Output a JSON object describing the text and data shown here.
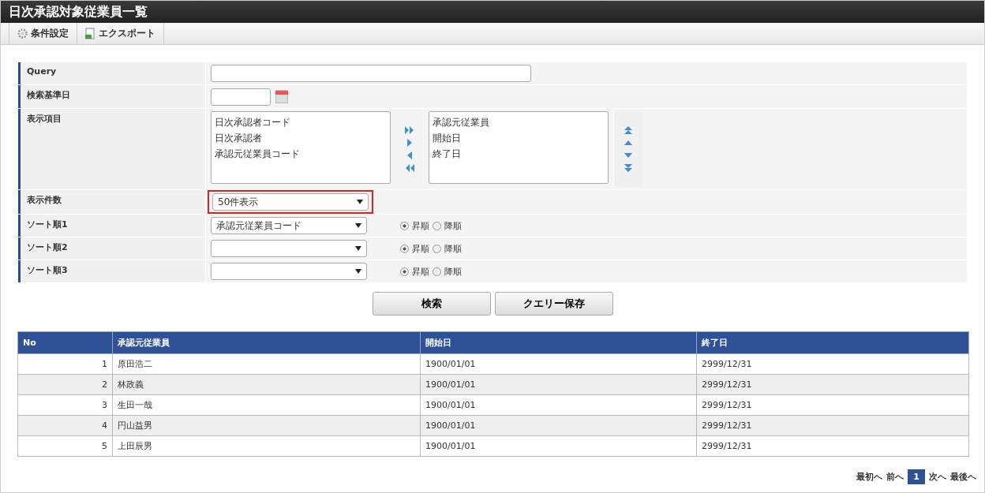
{
  "window": {
    "title": "日次承認対象従業員一覧"
  },
  "toolbar": [
    {
      "kind": "settings",
      "label": "条件設定"
    },
    {
      "kind": "export",
      "label": "エクスポート"
    }
  ],
  "form": {
    "query": {
      "label": "Query"
    },
    "base_date": {
      "label": "検索基準日"
    },
    "columns": {
      "label": "表示項目",
      "available": [
        "日次承認者コード",
        "日次承認者",
        "承認元従業員コード"
      ],
      "chosen": [
        "承認元従業員",
        "開始日",
        "終了日"
      ]
    },
    "count": {
      "label": "表示件数",
      "value": "50件表示",
      "highlighted": true
    },
    "sorts": [
      {
        "label": "ソート順1",
        "value": "承認元従業員コード",
        "options": [
          {
            "label": "昇順",
            "selected": true
          },
          {
            "label": "降順",
            "selected": false
          }
        ]
      },
      {
        "label": "ソート順2",
        "options": [
          {
            "label": "昇順",
            "selected": true
          },
          {
            "label": "降順",
            "selected": false
          }
        ]
      },
      {
        "label": "ソート順3",
        "options": [
          {
            "label": "昇順",
            "selected": true
          },
          {
            "label": "降順",
            "selected": false
          }
        ]
      }
    ]
  },
  "buttons": [
    "検索",
    "クエリー保存"
  ],
  "table": {
    "columns": [
      "No",
      "承認元従業員",
      "開始日",
      "終了日"
    ],
    "rows": [
      [
        "1",
        "原田浩二",
        "1900/01/01",
        "2999/12/31"
      ],
      [
        "2",
        "林政義",
        "1900/01/01",
        "2999/12/31"
      ],
      [
        "3",
        "生田一哉",
        "1900/01/01",
        "2999/12/31"
      ],
      [
        "4",
        "円山益男",
        "1900/01/01",
        "2999/12/31"
      ],
      [
        "5",
        "上田辰男",
        "1900/01/01",
        "2999/12/31"
      ]
    ]
  },
  "pagination": {
    "first": "最初へ",
    "prev": "前へ",
    "pages": [
      {
        "label": "1",
        "selected": true
      }
    ],
    "next": "次へ",
    "last": "最後へ"
  }
}
